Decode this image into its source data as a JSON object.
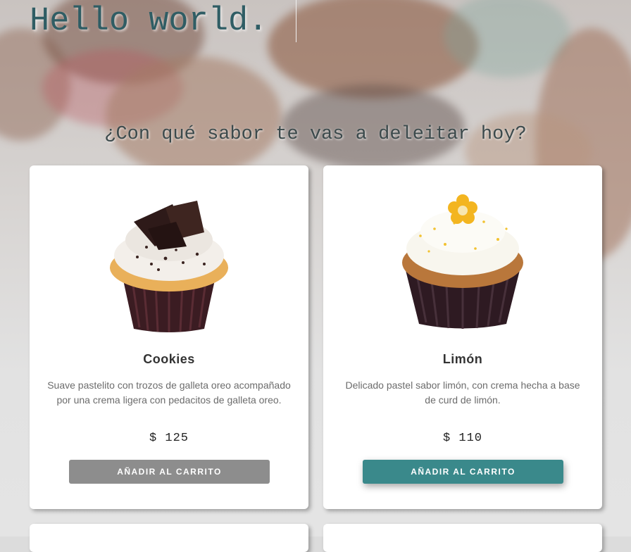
{
  "hero": {
    "title": "Hello world."
  },
  "subtitle": "¿Con qué sabor te vas a deleitar hoy?",
  "products": [
    {
      "name": "Cookies",
      "description": "Suave pastelito con trozos de galleta oreo acompañado por una crema ligera con pedacitos de galleta oreo.",
      "price": "$ 125",
      "button": "AÑADIR AL CARRITO",
      "image_icon": "cookies-cupcake-image"
    },
    {
      "name": "Limón",
      "description": "Delicado pastel sabor limón, con crema hecha a base de curd de limón.",
      "price": "$ 110",
      "button": "AÑADIR AL CARRITO",
      "image_icon": "lemon-cupcake-image"
    }
  ],
  "colors": {
    "accent": "#3a898b",
    "button_default": "#8d8d8d",
    "title": "#2f5d64"
  }
}
